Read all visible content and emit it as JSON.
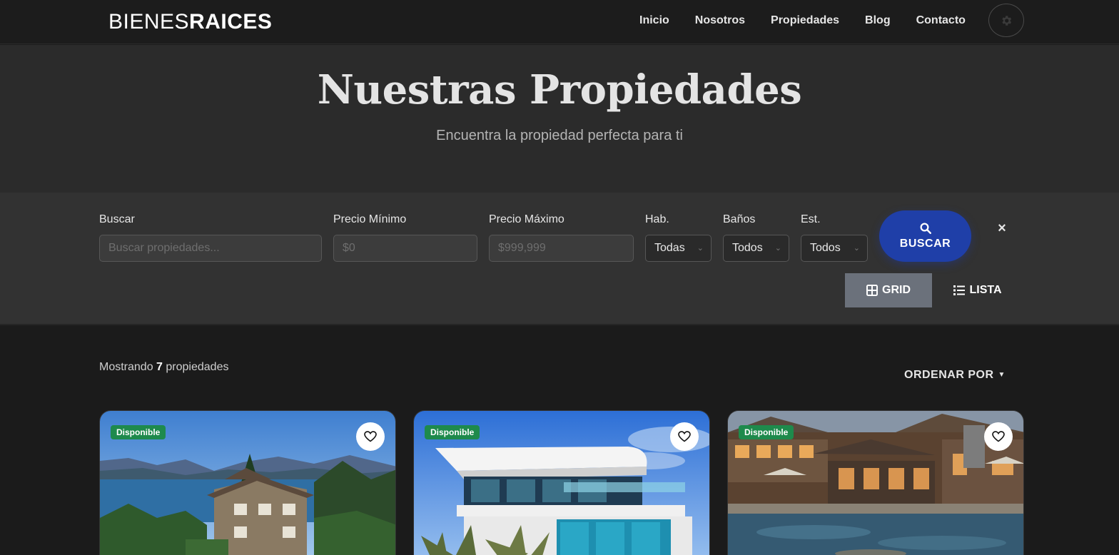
{
  "brand": {
    "light": "BIENES",
    "bold": "RAICES"
  },
  "nav": {
    "items": [
      {
        "label": "Inicio"
      },
      {
        "label": "Nosotros"
      },
      {
        "label": "Propiedades"
      },
      {
        "label": "Blog"
      },
      {
        "label": "Contacto"
      }
    ],
    "theme_icon": "gear-icon"
  },
  "hero": {
    "title": "Nuestras Propiedades",
    "subtitle": "Encuentra la propiedad perfecta para ti"
  },
  "filters": {
    "search": {
      "label": "Buscar",
      "placeholder": "Buscar propiedades..."
    },
    "min_price": {
      "label": "Precio Mínimo",
      "placeholder": "$0"
    },
    "max_price": {
      "label": "Precio Máximo",
      "placeholder": "$999,999"
    },
    "rooms": {
      "label": "Hab.",
      "value": "Todas"
    },
    "baths": {
      "label": "Baños",
      "value": "Todos"
    },
    "parking": {
      "label": "Est.",
      "value": "Todos"
    },
    "search_button": "BUSCAR",
    "clear_icon": "×"
  },
  "view": {
    "grid_label": "GRID",
    "list_label": "LISTA",
    "active": "grid"
  },
  "results": {
    "prefix": "Mostrando",
    "count": "7",
    "suffix": "propiedades"
  },
  "sort": {
    "label": "ORDENAR POR"
  },
  "cards": [
    {
      "badge": "Disponible",
      "scene": "mountain-lake-house"
    },
    {
      "badge": "Disponible",
      "scene": "modern-white-house"
    },
    {
      "badge": "Disponible",
      "scene": "lodge-with-pool"
    }
  ],
  "colors": {
    "accent": "#1f3fa8",
    "badge": "#1e8a4c",
    "navbar": "#1c1c1c",
    "hero": "#2b2b2b",
    "filters": "#323232",
    "page": "#1b1b1b"
  }
}
